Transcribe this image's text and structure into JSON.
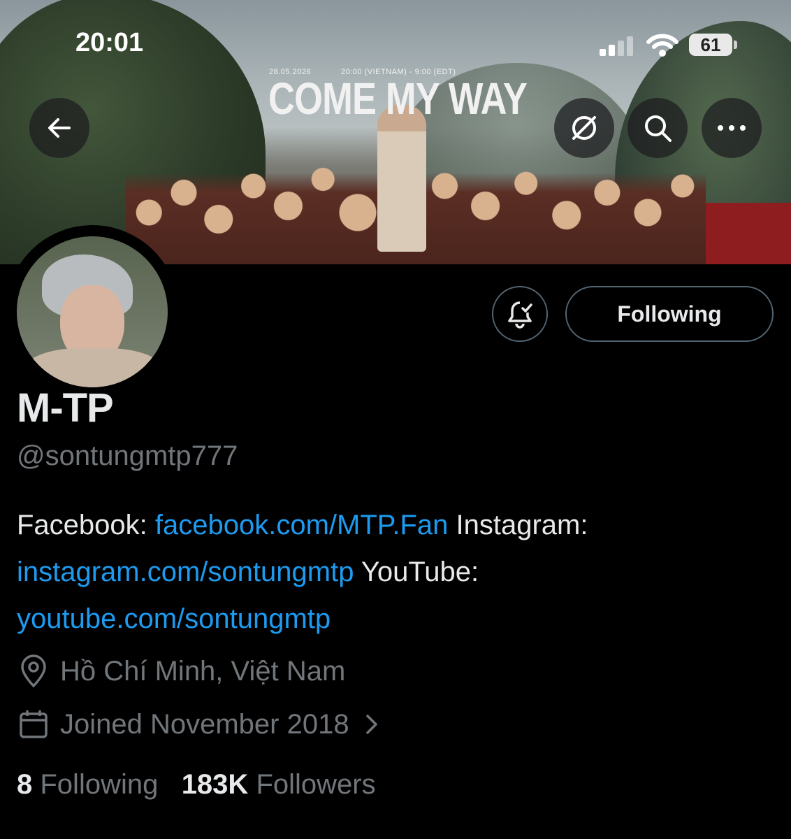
{
  "status_bar": {
    "time": "20:01",
    "battery": "61"
  },
  "banner": {
    "poster_date": "28.05.2026",
    "poster_time": "20:00 (VIETNAM) - 9:00 (EDT)",
    "poster_title": "COME MY WAY"
  },
  "icons": {
    "back": "arrow-left-icon",
    "grok": "slash-circle-icon",
    "search": "search-icon",
    "more": "more-horizontal-icon",
    "notify": "bell-check-icon",
    "location": "location-pin-icon",
    "calendar": "calendar-icon",
    "chevron": "chevron-right-icon"
  },
  "actions": {
    "following_label": "Following"
  },
  "profile": {
    "name": "M-TP",
    "handle": "@sontungmtp777",
    "bio": {
      "facebook_label": "Facebook:",
      "facebook_link": "facebook.com/MTP.Fan",
      "instagram_label": "Instagram:",
      "instagram_link": "instagram.com/sontungmtp",
      "youtube_label": "YouTube:",
      "youtube_link": "youtube.com/sontungmtp"
    },
    "location": "Hồ Chí Minh, Việt Nam",
    "joined": "Joined November 2018",
    "following_count": "8",
    "following_label": "Following",
    "followers_count": "183K",
    "followers_label": "Followers"
  },
  "colors": {
    "link": "#1d9bf0",
    "muted": "#71767b",
    "text": "#e7e9ea",
    "border": "#536471"
  }
}
